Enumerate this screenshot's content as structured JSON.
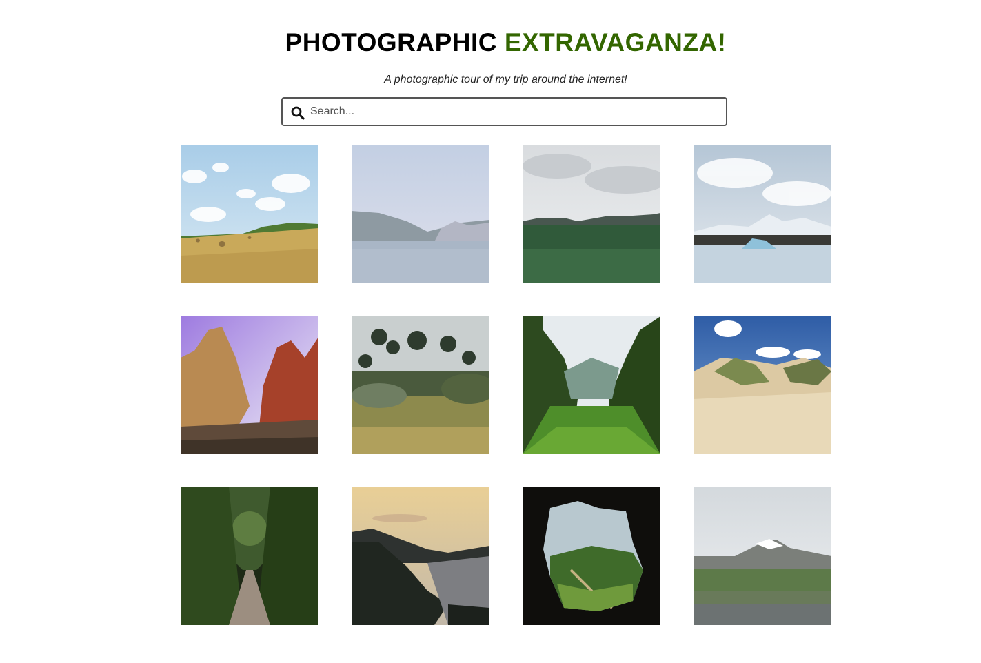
{
  "header": {
    "title_part1": "PHOTOGRAPHIC",
    "title_part2": "EXTRAVAGANZA!",
    "subtitle": "A photographic tour of my trip around the internet!",
    "accent_color": "#336600"
  },
  "search": {
    "placeholder": "Search...",
    "value": "",
    "icon": "search-icon"
  },
  "gallery": {
    "photos": [
      {
        "scene": "hay-field"
      },
      {
        "scene": "misty-lake"
      },
      {
        "scene": "green-meadow"
      },
      {
        "scene": "glacier-lagoon"
      },
      {
        "scene": "canyon-cliffs"
      },
      {
        "scene": "garden-trees"
      },
      {
        "scene": "jungle-valley"
      },
      {
        "scene": "sand-dunes"
      },
      {
        "scene": "forest-path"
      },
      {
        "scene": "coastal-sunset"
      },
      {
        "scene": "cave-opening"
      },
      {
        "scene": "lupine-field"
      }
    ]
  }
}
